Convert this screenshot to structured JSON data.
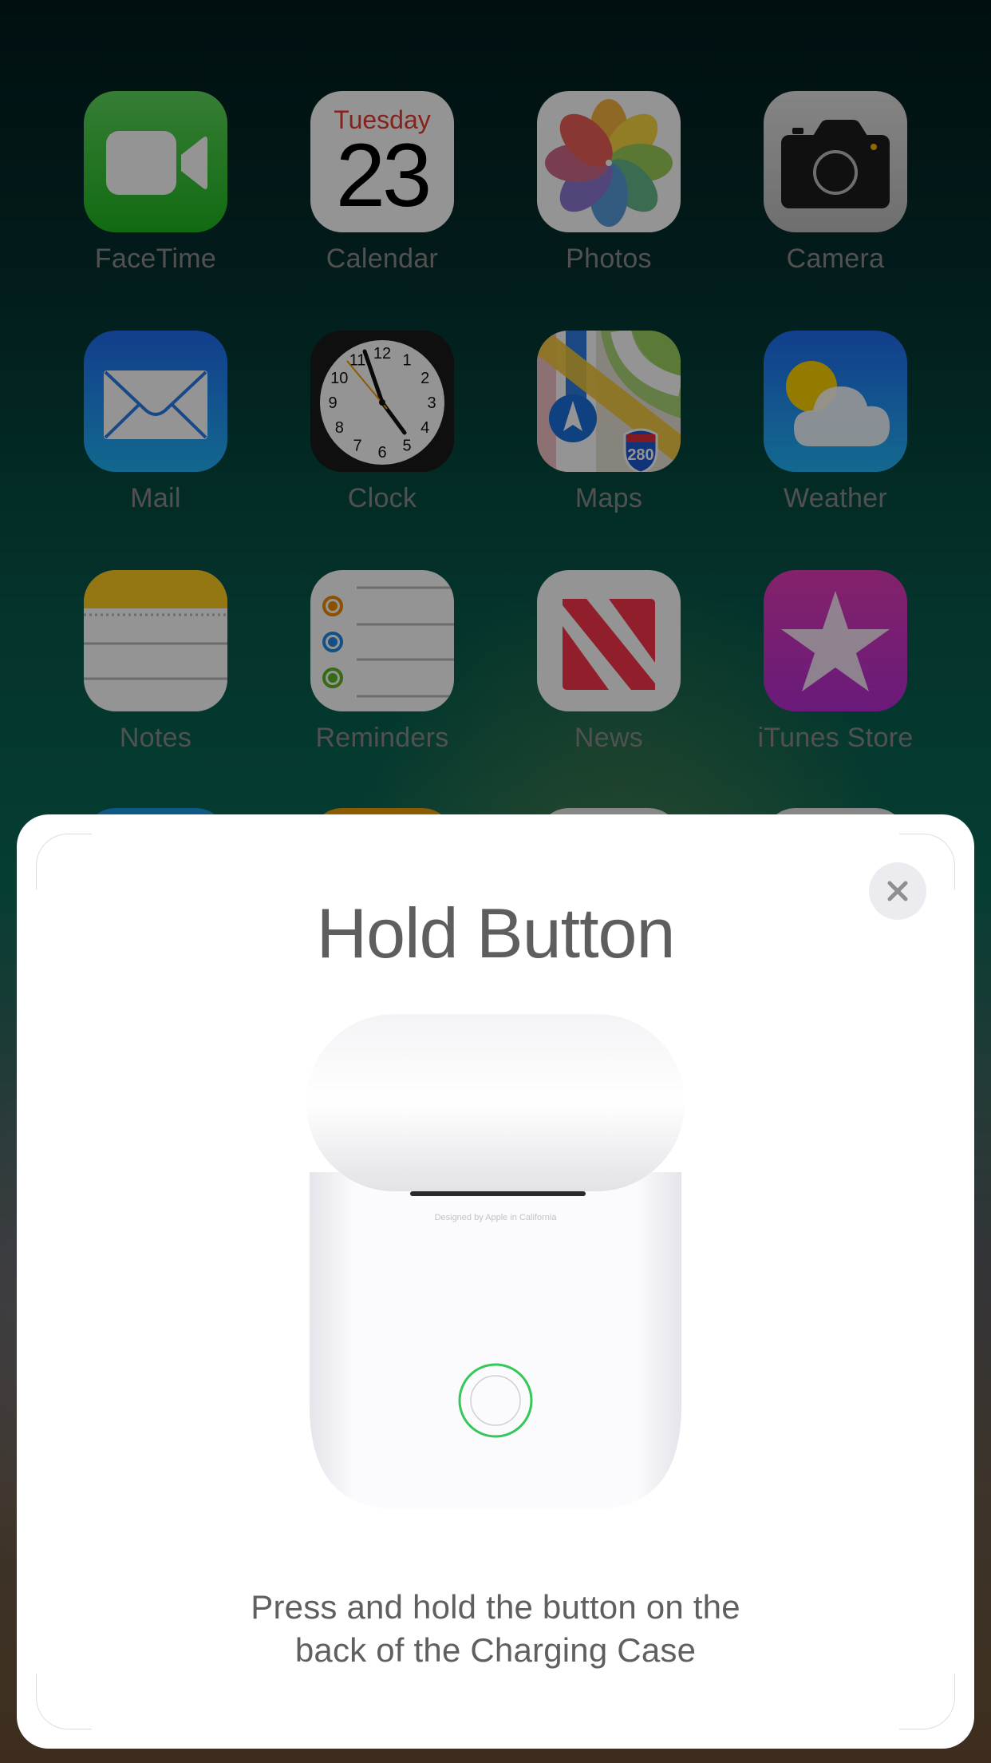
{
  "home_screen": {
    "apps": [
      {
        "name": "FaceTime",
        "icon": "facetime-icon"
      },
      {
        "name": "Calendar",
        "icon": "calendar-icon",
        "weekday": "Tuesday",
        "day": "23"
      },
      {
        "name": "Photos",
        "icon": "photos-icon"
      },
      {
        "name": "Camera",
        "icon": "camera-icon"
      },
      {
        "name": "Mail",
        "icon": "mail-icon"
      },
      {
        "name": "Clock",
        "icon": "clock-icon",
        "numerals": [
          "12",
          "1",
          "2",
          "3",
          "4",
          "5",
          "6",
          "7",
          "8",
          "9",
          "10",
          "11"
        ]
      },
      {
        "name": "Maps",
        "icon": "maps-icon",
        "shield": "280"
      },
      {
        "name": "Weather",
        "icon": "weather-icon"
      },
      {
        "name": "Notes",
        "icon": "notes-icon"
      },
      {
        "name": "Reminders",
        "icon": "reminders-icon"
      },
      {
        "name": "News",
        "icon": "news-icon"
      },
      {
        "name": "iTunes Store",
        "icon": "itunes-store-icon"
      }
    ]
  },
  "pairing_sheet": {
    "title": "Hold Button",
    "close_icon": "close-icon",
    "case_engraving": "Designed by Apple in California",
    "instruction": "Press and hold the button on the back of the Charging Case",
    "accent_color": "#34c759"
  }
}
